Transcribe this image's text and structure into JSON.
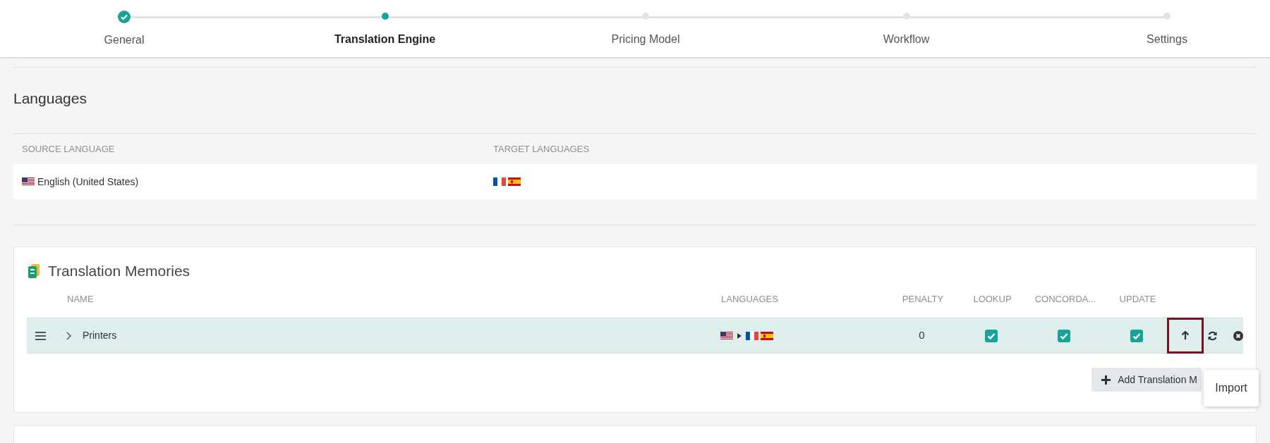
{
  "steps": [
    {
      "label": "General",
      "completed": true,
      "selected": false
    },
    {
      "label": "Translation Engine",
      "completed": false,
      "selected": true
    },
    {
      "label": "Pricing Model",
      "completed": false,
      "selected": false
    },
    {
      "label": "Workflow",
      "completed": false,
      "selected": false
    },
    {
      "label": "Settings",
      "completed": false,
      "selected": false
    }
  ],
  "languages": {
    "title": "Languages",
    "columns": [
      "SOURCE LANGUAGE",
      "TARGET LANGUAGES"
    ],
    "source": {
      "kind": "us",
      "label": "English (United States)"
    },
    "targets": [
      {
        "kind": "fr"
      },
      {
        "kind": "es"
      }
    ]
  },
  "translation_memories": {
    "title": "Translation Memories",
    "columns": [
      "NAME",
      "LANGUAGES",
      "PENALTY",
      "LOOKUP",
      "CONCORDA...",
      "UPDATE"
    ],
    "rows": [
      {
        "name": "Printers",
        "expanded": false,
        "source_flag": {
          "kind": "us"
        },
        "target_flags": [
          {
            "kind": "fr"
          },
          {
            "kind": "es"
          }
        ],
        "penalty": "0",
        "lookup": true,
        "concordance": true,
        "update": true
      }
    ],
    "add_button": "Add Translation M",
    "tooltip": "Import"
  }
}
